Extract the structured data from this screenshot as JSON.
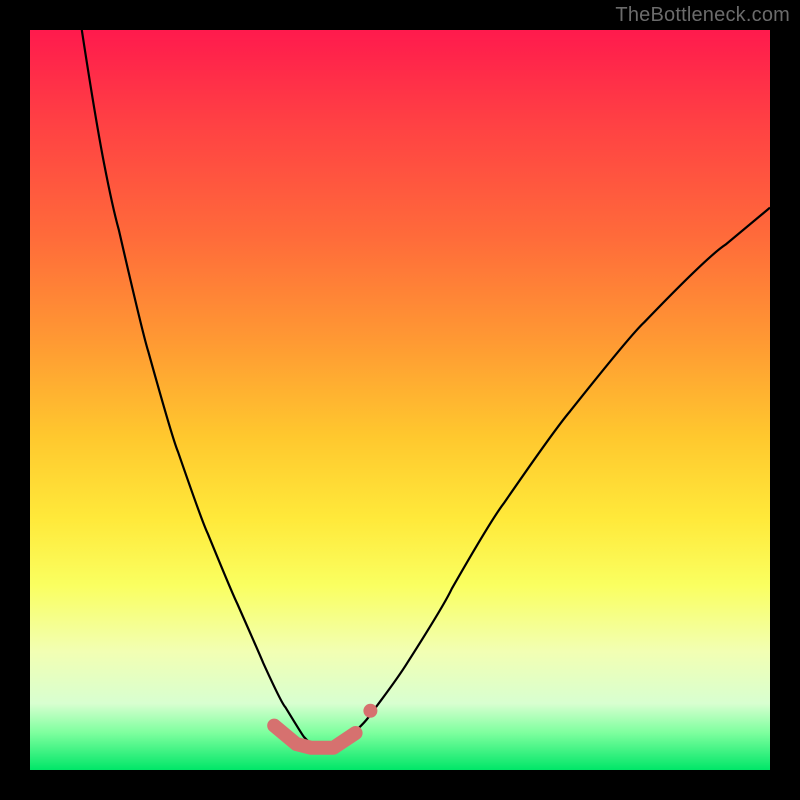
{
  "watermark": "TheBottleneck.com",
  "colors": {
    "frame": "#000000",
    "curve": "#000000",
    "marker": "#d6716f",
    "gradient_top": "#ff1a4d",
    "gradient_bottom": "#00e668"
  },
  "chart_data": {
    "type": "line",
    "title": "",
    "xlabel": "",
    "ylabel": "",
    "xlim": [
      0,
      100
    ],
    "ylim": [
      0,
      100
    ],
    "grid": false,
    "legend": false,
    "notes": "Axes are unlabeled; x/y in percent of plot area. y=0 at bottom (green), y=100 at top (red). Curve is a V-shaped bottleneck profile with minimum near x≈38.",
    "series": [
      {
        "name": "bottleneck-curve",
        "x": [
          7,
          10,
          14,
          18,
          22,
          26,
          30,
          33,
          36,
          38,
          41,
          44,
          48,
          54,
          60,
          68,
          78,
          88,
          100
        ],
        "y": [
          100,
          82,
          64,
          49,
          37,
          27,
          18,
          11,
          6,
          3,
          3,
          5,
          10,
          19,
          30,
          42,
          55,
          66,
          76
        ]
      }
    ],
    "highlight": {
      "name": "minimum-region",
      "x": [
        33,
        36,
        38,
        41,
        44
      ],
      "y": [
        6,
        3.5,
        3,
        3,
        5
      ],
      "extra_point": {
        "x": 46,
        "y": 8
      }
    }
  }
}
